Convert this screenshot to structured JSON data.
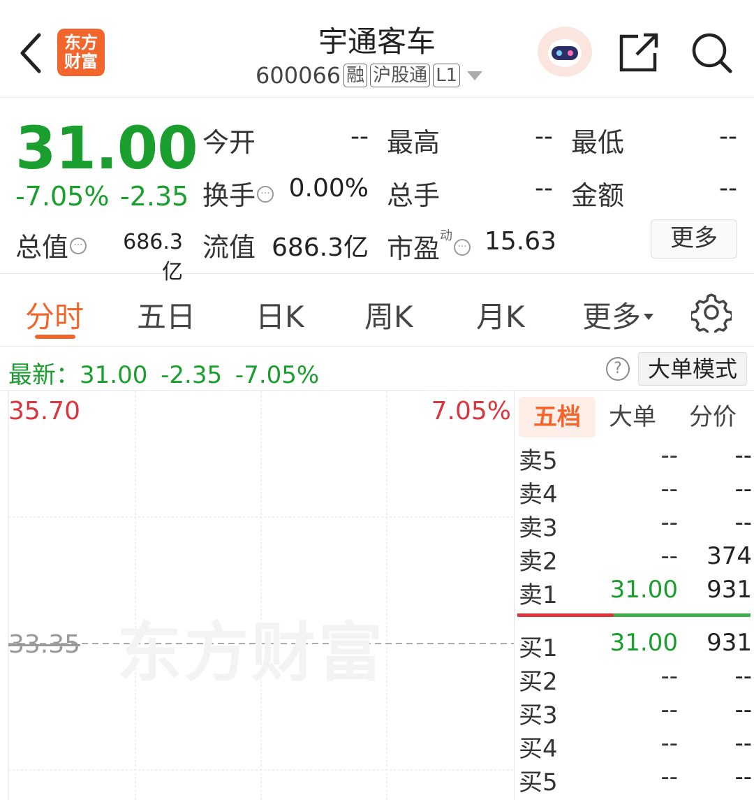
{
  "header": {
    "title": "宇通客车",
    "code": "600066",
    "tags": [
      "融",
      "沪股通",
      "L1"
    ],
    "logo_text": [
      "东方",
      "财富"
    ],
    "icons": [
      "back-arrow-icon",
      "share-icon",
      "search-icon",
      "robot-assistant-icon"
    ]
  },
  "quote": {
    "price": "31.00",
    "change_pct": "-7.05%",
    "change_amt": "-2.35",
    "open_label": "今开",
    "open_value": "--",
    "high_label": "最高",
    "high_value": "--",
    "low_label": "最低",
    "low_value": "--",
    "turnover_label": "换手",
    "turnover_value": "0.00%",
    "volume_label": "总手",
    "volume_value": "--",
    "amount_label": "金额",
    "amount_value": "--",
    "mktcap_label": "总值",
    "mktcap_value": "686.3亿",
    "float_label": "流值",
    "float_value": "686.3亿",
    "pe_label": "市盈",
    "pe_sup": "动",
    "pe_value": "15.63",
    "more_label": "更多"
  },
  "tabs": [
    {
      "label": "分时",
      "active": true
    },
    {
      "label": "五日"
    },
    {
      "label": "日K"
    },
    {
      "label": "周K"
    },
    {
      "label": "月K"
    },
    {
      "label": "更多"
    }
  ],
  "latest": {
    "text": "最新：31.00 -2.35 -7.05%",
    "help": "?",
    "mode_label": "大单模式"
  },
  "chart": {
    "y_top": "35.70",
    "pct_top": "7.05%",
    "y_mid": "33.35",
    "watermark": "东方财富"
  },
  "book": {
    "tabs": [
      "五档",
      "大单",
      "分价"
    ],
    "asks": [
      {
        "label": "卖5",
        "price": "--",
        "vol": "--"
      },
      {
        "label": "卖4",
        "price": "--",
        "vol": "--"
      },
      {
        "label": "卖3",
        "price": "--",
        "vol": "--"
      },
      {
        "label": "卖2",
        "price": "--",
        "vol": "374"
      },
      {
        "label": "卖1",
        "price": "31.00",
        "vol": "931"
      }
    ],
    "bids": [
      {
        "label": "买1",
        "price": "31.00",
        "vol": "931"
      },
      {
        "label": "买2",
        "price": "--",
        "vol": "--"
      },
      {
        "label": "买3",
        "price": "--",
        "vol": "--"
      },
      {
        "label": "买4",
        "price": "--",
        "vol": "--"
      },
      {
        "label": "买5",
        "price": "--",
        "vol": "--"
      }
    ]
  },
  "colors": {
    "up_red": "#d9363e",
    "down_green": "#1a9e2e",
    "accent_orange": "#f2662e"
  }
}
